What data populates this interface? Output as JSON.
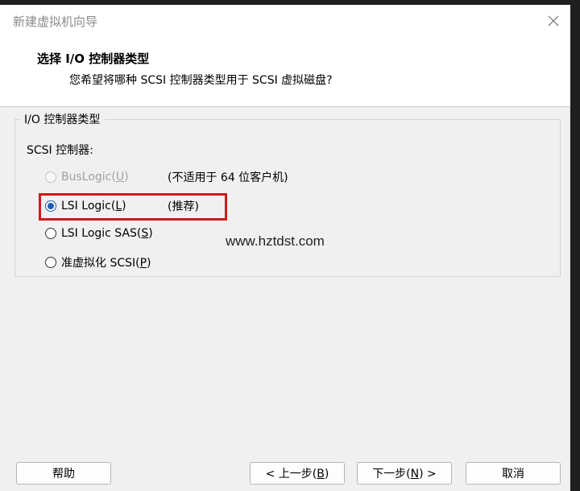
{
  "window": {
    "title": "新建虚拟机向导",
    "close_icon": "close-icon"
  },
  "header": {
    "title": "选择 I/O 控制器类型",
    "subtitle": "您希望将哪种 SCSI 控制器类型用于 SCSI 虚拟磁盘?"
  },
  "group": {
    "legend": "I/O 控制器类型",
    "section_label": "SCSI 控制器:",
    "options": [
      {
        "label_prefix": "BusLogic(",
        "accel": "U",
        "label_suffix": ")",
        "note": "(不适用于 64 位客户机)",
        "state": "disabled"
      },
      {
        "label_prefix": "LSI Logic(",
        "accel": "L",
        "label_suffix": ")",
        "note": "(推荐)",
        "state": "checked"
      },
      {
        "label_prefix": "LSI Logic SAS(",
        "accel": "S",
        "label_suffix": ")",
        "note": "",
        "state": "unchecked"
      },
      {
        "label_prefix": "准虚拟化 SCSI(",
        "accel": "P",
        "label_suffix": ")",
        "note": "",
        "state": "unchecked"
      }
    ]
  },
  "watermark": "www.hztdst.com",
  "buttons": {
    "help": "帮助",
    "back_prefix": "< 上一步(",
    "back_accel": "B",
    "back_suffix": ")",
    "next_prefix": "下一步(",
    "next_accel": "N",
    "next_suffix": ") >",
    "cancel": "取消"
  },
  "colors": {
    "highlight": "#d01818",
    "radio_accent": "#1a5fb4"
  }
}
